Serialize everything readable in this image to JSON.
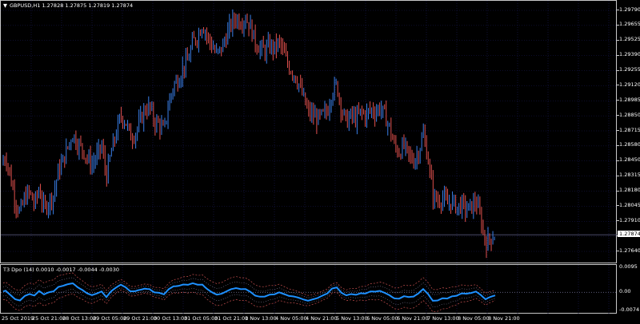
{
  "symbol_title": "GBPUSD,H1  1.27828 1.27875 1.27819 1.27874",
  "indicator_title": "T3 Dpo (14) 0.0010 -0.0017 -0.0044 -0.0030",
  "current_price": "1.27874",
  "price_axis_labels": [
    "1.29790",
    "1.29655",
    "1.29525",
    "1.29390",
    "1.29255",
    "1.29120",
    "1.28985",
    "1.28850",
    "1.28715",
    "1.28580",
    "1.28450",
    "1.28315",
    "1.28180",
    "1.28045",
    "1.27910",
    "1.27775",
    "1.27640"
  ],
  "indicator_axis_labels": [
    "0.0095",
    "0.00",
    "-0.0074"
  ],
  "time_labels": [
    "25 Oct 2019",
    "25 Oct 21:00",
    "28 Oct 13:00",
    "29 Oct 05:00",
    "29 Oct 21:00",
    "30 Oct 13:00",
    "31 Oct 05:00",
    "31 Oct 21:00",
    "1 Nov 13:00",
    "4 Nov 05:00",
    "4 Nov 21:00",
    "5 Nov 13:00",
    "6 Nov 05:00",
    "6 Nov 21:00",
    "7 Nov 13:00",
    "8 Nov 05:00",
    "8 Nov 21:00"
  ],
  "colors": {
    "bull": "#3a7fe8",
    "bear": "#e0504d",
    "grid": "#1a1a5a",
    "indicator_line": "#1e90ff",
    "bands": "#c85050",
    "bands_inner": "#8080a0"
  },
  "chart_data": {
    "type": "candlestick",
    "symbol": "GBPUSD",
    "timeframe": "H1",
    "ylim": [
      1.2764,
      1.2979
    ],
    "close_path": [
      [
        0,
        1.2845
      ],
      [
        6,
        1.2852
      ],
      [
        12,
        1.2835
      ],
      [
        18,
        1.2815
      ],
      [
        24,
        1.2805
      ],
      [
        30,
        1.2818
      ],
      [
        36,
        1.2822
      ],
      [
        42,
        1.2812
      ],
      [
        48,
        1.2825
      ],
      [
        54,
        1.2808
      ],
      [
        60,
        1.2815
      ],
      [
        66,
        1.282
      ],
      [
        72,
        1.284
      ],
      [
        78,
        1.2848
      ],
      [
        84,
        1.286
      ],
      [
        90,
        1.287
      ],
      [
        96,
        1.2862
      ],
      [
        102,
        1.2858
      ],
      [
        108,
        1.285
      ],
      [
        114,
        1.2845
      ],
      [
        120,
        1.2852
      ],
      [
        126,
        1.286
      ],
      [
        132,
        1.2835
      ],
      [
        138,
        1.2855
      ],
      [
        144,
        1.287
      ],
      [
        150,
        1.2885
      ],
      [
        156,
        1.288
      ],
      [
        162,
        1.2868
      ],
      [
        168,
        1.287
      ],
      [
        174,
        1.288
      ],
      [
        180,
        1.289
      ],
      [
        186,
        1.2892
      ],
      [
        192,
        1.288
      ],
      [
        198,
        1.2878
      ],
      [
        204,
        1.2872
      ],
      [
        210,
        1.2895
      ],
      [
        216,
        1.291
      ],
      [
        222,
        1.2915
      ],
      [
        228,
        1.2925
      ],
      [
        234,
        1.293
      ],
      [
        240,
        1.2945
      ],
      [
        246,
        1.295
      ],
      [
        252,
        1.296
      ],
      [
        258,
        1.295
      ],
      [
        264,
        1.2942
      ],
      [
        270,
        1.2935
      ],
      [
        276,
        1.294
      ],
      [
        282,
        1.295
      ],
      [
        288,
        1.296
      ],
      [
        294,
        1.2965
      ],
      [
        300,
        1.2962
      ],
      [
        306,
        1.2965
      ],
      [
        312,
        1.2958
      ],
      [
        318,
        1.2945
      ],
      [
        324,
        1.294
      ],
      [
        330,
        1.2938
      ],
      [
        336,
        1.2942
      ],
      [
        342,
        1.294
      ],
      [
        348,
        1.2945
      ],
      [
        354,
        1.2935
      ],
      [
        360,
        1.2925
      ],
      [
        366,
        1.292
      ],
      [
        372,
        1.2912
      ],
      [
        378,
        1.29
      ],
      [
        384,
        1.2888
      ],
      [
        390,
        1.2885
      ],
      [
        396,
        1.2882
      ],
      [
        402,
        1.2885
      ],
      [
        408,
        1.2888
      ],
      [
        414,
        1.2905
      ],
      [
        420,
        1.291
      ],
      [
        426,
        1.289
      ],
      [
        432,
        1.288
      ],
      [
        438,
        1.2885
      ],
      [
        444,
        1.2882
      ],
      [
        450,
        1.2888
      ],
      [
        456,
        1.2885
      ],
      [
        462,
        1.289
      ],
      [
        468,
        1.2888
      ],
      [
        474,
        1.2892
      ],
      [
        480,
        1.2885
      ],
      [
        486,
        1.2875
      ],
      [
        492,
        1.286
      ],
      [
        498,
        1.2855
      ],
      [
        504,
        1.286
      ],
      [
        510,
        1.2852
      ],
      [
        516,
        1.2848
      ],
      [
        522,
        1.2855
      ],
      [
        528,
        1.287
      ],
      [
        534,
        1.285
      ],
      [
        540,
        1.282
      ],
      [
        546,
        1.2815
      ],
      [
        552,
        1.2818
      ],
      [
        558,
        1.2812
      ],
      [
        564,
        1.2815
      ],
      [
        570,
        1.281
      ],
      [
        576,
        1.2812
      ],
      [
        582,
        1.2808
      ],
      [
        588,
        1.281
      ],
      [
        594,
        1.2815
      ],
      [
        600,
        1.28
      ],
      [
        606,
        1.278
      ],
      [
        612,
        1.2785
      ],
      [
        618,
        1.2787
      ]
    ],
    "indicator": {
      "name": "T3 Dpo (14)",
      "values_shown": [
        0.001,
        -0.0017,
        -0.0044,
        -0.003
      ],
      "ylim": [
        -0.0074,
        0.0095
      ]
    }
  }
}
